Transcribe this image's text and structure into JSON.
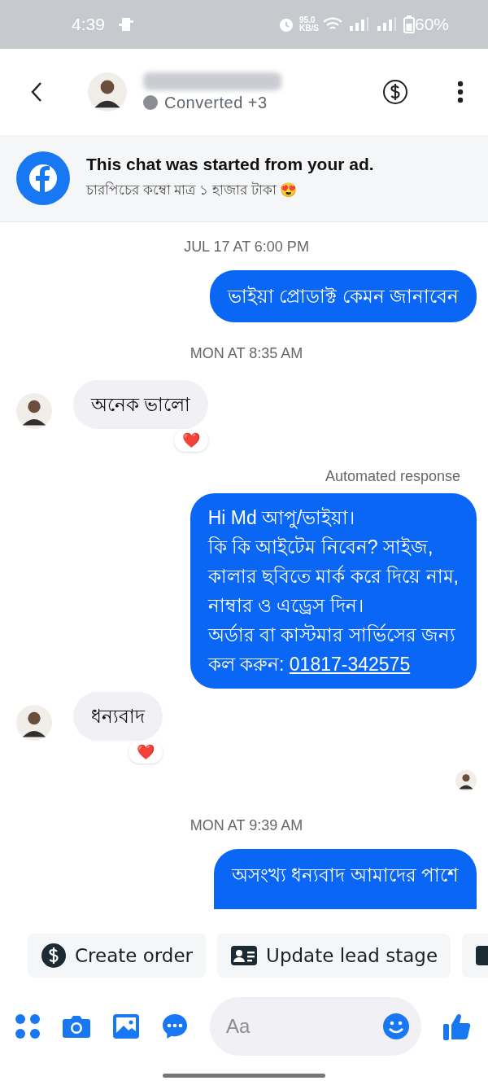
{
  "status_bar": {
    "time": "4:39",
    "speed": "95.0",
    "speed_unit": "KB/S",
    "battery": "60%"
  },
  "header": {
    "status_dot": {
      "color": "#8a8d91"
    },
    "status": "Converted +3"
  },
  "ad_banner": {
    "title": "This chat was started from your ad.",
    "subtitle": "চারপিচের কম্বো মাত্র ১ হাজার টাকা 😍"
  },
  "messages": [
    {
      "kind": "timestamp",
      "text": "JUL 17 AT 6:00 PM"
    },
    {
      "kind": "outgoing",
      "text": "ভাইয়া প্রোডাক্ট কেমন জানাবেন"
    },
    {
      "kind": "timestamp",
      "text": "MON AT 8:35 AM"
    },
    {
      "kind": "incoming",
      "text": "অনেক ভালো",
      "reaction": "❤️"
    },
    {
      "kind": "label",
      "text": "Automated response"
    },
    {
      "kind": "outgoing",
      "lines": [
        "Hi Md  আপু/ভাইয়া।",
        "কি কি আইটেম নিবেন? সাইজ,",
        "কালার ছবিতে মার্ক করে দিয়ে নাম,",
        "নাম্বার ও এড্রেস দিন।",
        "অর্ডার বা কাস্টমার সার্ভিসের জন্য"
      ],
      "last_line": "কল করুন: ",
      "link": "01817-342575"
    },
    {
      "kind": "incoming",
      "text": "ধন্যবাদ",
      "reaction": "❤️"
    },
    {
      "kind": "seen"
    },
    {
      "kind": "timestamp",
      "text": "MON AT 9:39 AM"
    },
    {
      "kind": "outgoing",
      "text": "অসংখ্য ধন্যবাদ আমাদের পাশে",
      "cut": true
    }
  ],
  "actions": [
    {
      "kind": "order",
      "label": "Create order"
    },
    {
      "kind": "lead",
      "label": "Update lead stage"
    },
    {
      "kind": "more"
    }
  ],
  "composer": {
    "placeholder": "Aa"
  }
}
